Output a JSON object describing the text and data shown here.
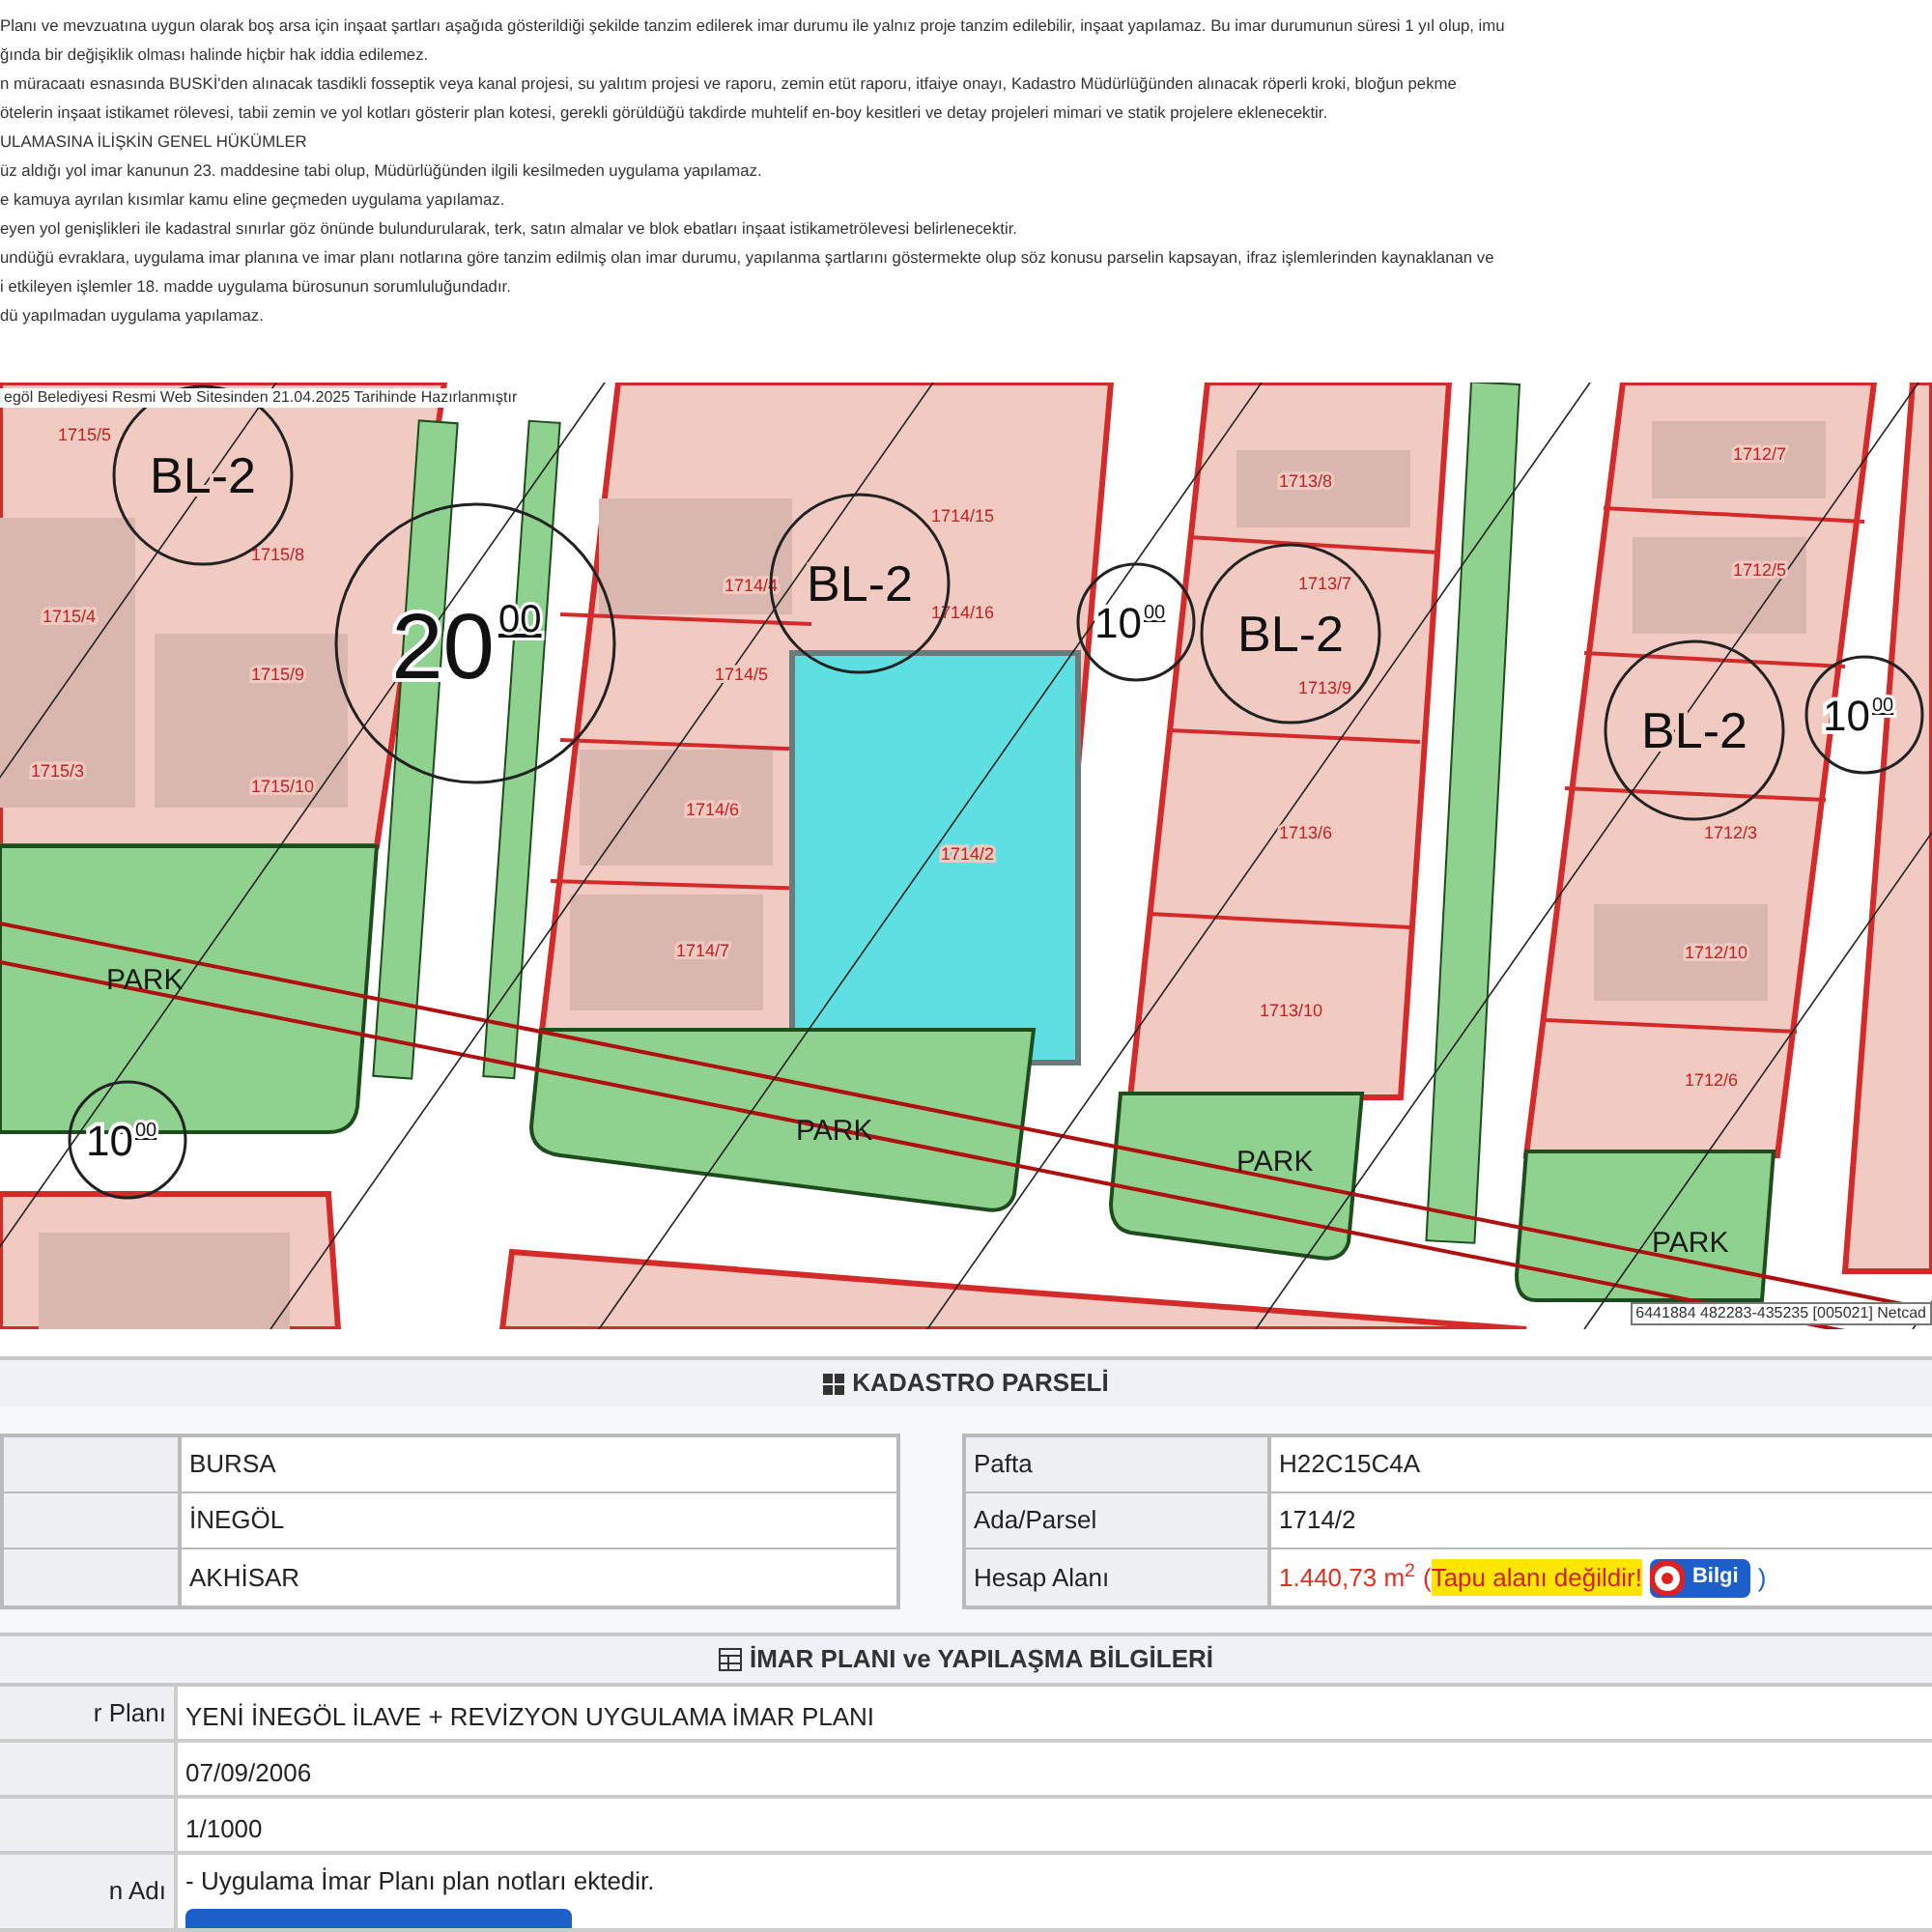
{
  "notes": [
    "Planı ve mevzuatına uygun olarak boş arsa için inşaat şartları aşağıda gösterildiği şekilde tanzim edilerek imar durumu ile yalnız proje tanzim edilebilir, inşaat yapılamaz. Bu imar durumunun süresi 1 yıl olup, imu",
    "ğında bir değişiklik olması halinde hiçbir hak iddia edilemez.",
    "n müracaatı esnasında BUSKİ'den alınacak tasdikli fosseptik veya kanal projesi, su yalıtım projesi ve raporu, zemin etüt raporu, itfaiye onayı, Kadastro Müdürlüğünden alınacak röperli kroki, bloğun pekme",
    "ötelerin inşaat istikamet rölevesi, tabii zemin ve yol kotları gösterir plan kotesi, gerekli görüldüğü takdirde muhtelif en-boy kesitleri ve detay projeleri mimari ve statik projelere eklenecektir.",
    "ULAMASINA İLİŞKİN GENEL HÜKÜMLER",
    "üz aldığı yol imar kanunun 23. maddesine tabi olup, Müdürlüğünden ilgili kesilmeden uygulama yapılamaz.",
    "e kamuya ayrılan kısımlar kamu eline geçmeden uygulama yapılamaz.",
    "eyen yol genişlikleri ile kadastral sınırlar göz önünde bulundurularak, terk, satın almalar ve blok ebatları inşaat istikametrölevesi belirlenecektir.",
    "undüğü evraklara, uygulama imar planına ve imar planı notlarına göre tanzim edilmiş olan imar durumu, yapılanma şartlarını göstermekte olup söz konusu parselin kapsayan, ifraz işlemlerinden kaynaklanan ve",
    "i etkileyen işlemler 18. madde uygulama bürosunun sorumluluğundadır.",
    "dü yapılmadan uygulama yapılamaz."
  ],
  "map": {
    "credit": "egöl Belediyesi Resmi Web Sitesinden 21.04.2025 Tarihinde Hazırlanmıştır",
    "coordinates": "6441884 482283-435235 [005021] Netcad",
    "labels": [
      {
        "kind": "zone",
        "text": "BL-2"
      },
      {
        "kind": "zone",
        "text": "BL-2"
      },
      {
        "kind": "zone",
        "text": "BL-2"
      },
      {
        "kind": "zone",
        "text": "BL-2"
      },
      {
        "kind": "width",
        "text": "20",
        "sup": "00"
      },
      {
        "kind": "width",
        "text": "10",
        "sup": "00"
      },
      {
        "kind": "width",
        "text": "10",
        "sup": "00"
      },
      {
        "kind": "width",
        "text": "10",
        "sup": "00"
      },
      {
        "kind": "park",
        "text": "PARK"
      },
      {
        "kind": "park",
        "text": "PARK"
      },
      {
        "kind": "park",
        "text": "PARK"
      },
      {
        "kind": "park",
        "text": "PARK"
      }
    ],
    "parcels": [
      "1715/5",
      "1715/8",
      "1715/4",
      "1715/9",
      "1715/3",
      "1715/10",
      "1714/4",
      "1714/15",
      "1714/16",
      "1714/5",
      "1714/6",
      "1714/7",
      "1714/2",
      "1713/8",
      "1713/7",
      "1713/9",
      "1713/6",
      "1713/10",
      "1712/7",
      "1712/5",
      "1712/3",
      "1712/10",
      "1712/6"
    ]
  },
  "cadastre": {
    "title": "KADASTRO PARSELİ",
    "left_rows": [
      {
        "value": "BURSA"
      },
      {
        "value": "İNEGÖL"
      },
      {
        "value": "AKHİSAR"
      }
    ],
    "right_rows": [
      {
        "kind": "text",
        "label": "Pafta",
        "value": "H22C15C4A"
      },
      {
        "kind": "text",
        "label": "Ada/Parsel",
        "value": "1714/2"
      },
      {
        "kind": "area",
        "label": "Hesap Alanı",
        "value": "1.440,73 m$^{2}$",
        "open": "(",
        "warning": "Tapu alanı değildir!",
        "info_button": "Bilgi",
        "close": ")"
      }
    ]
  },
  "zoning": {
    "title": "İMAR PLANI ve YAPILAŞMA BİLGİLERİ",
    "rows": [
      {
        "kind": "text",
        "label": "r Planı",
        "value": "YENİ İNEGÖL İLAVE + REVİZYON UYGULAMA İMAR PLANI"
      },
      {
        "kind": "text",
        "value": "07/09/2006"
      },
      {
        "kind": "text",
        "value": "1/1000"
      },
      {
        "kind": "attachment",
        "label": "n Adı",
        "value": "- Uygulama İmar Planı plan notları ektedir."
      }
    ]
  }
}
